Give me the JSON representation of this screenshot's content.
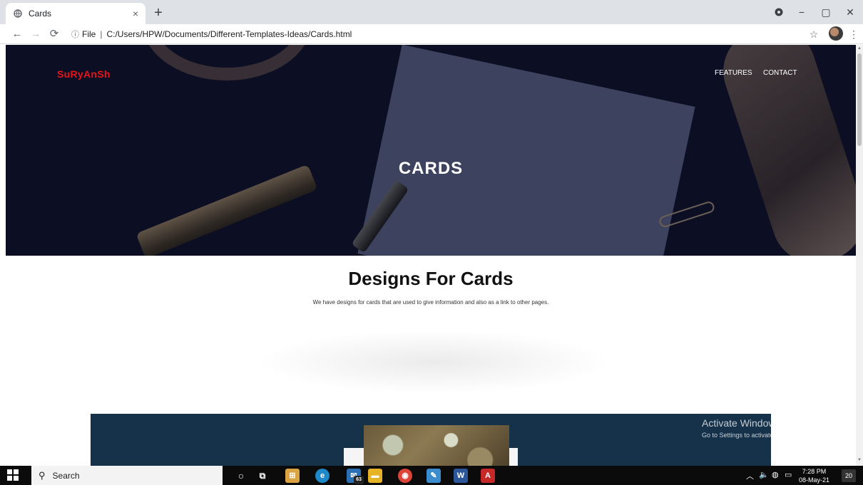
{
  "browser": {
    "tab_title": "Cards",
    "tab_close": "×",
    "new_tab": "+",
    "url_prefix": "File",
    "url": "C:/Users/HPW/Documents/Different-Templates-Ideas/Cards.html",
    "window_controls": [
      "−",
      "▢",
      "✕"
    ]
  },
  "page": {
    "brand": "SuRyAnSh",
    "nav": [
      "FEATURES",
      "CONTACT"
    ],
    "hero_title": "CARDS",
    "section_title": "Designs For Cards",
    "section_subtitle": "We have designs for cards that are used to give information and also as a link to other pages."
  },
  "watermark": {
    "line1": "Activate Windows",
    "line2": "Go to Settings to activate Windows."
  },
  "taskbar": {
    "search_placeholder": "Search",
    "mail_badge": "63",
    "time": "7:28 PM",
    "date": "08-May-21",
    "notification_count": "20"
  },
  "colors": {
    "brand": "#e8141a",
    "hero_bg": "#0e1024",
    "cards_strip": "#16324a"
  }
}
